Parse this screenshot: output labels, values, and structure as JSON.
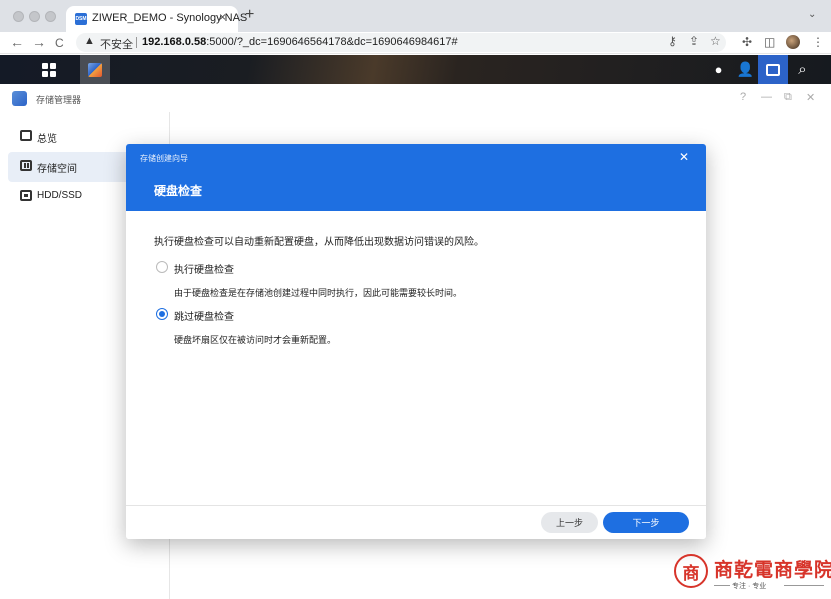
{
  "browser": {
    "tab_title": "ZIWER_DEMO - Synology NAS",
    "favicon_text": "DSM",
    "tab_close": "×",
    "new_tab": "+",
    "tab_menu": "⌄",
    "insecure_label": "不安全",
    "url_host": "192.168.0.58",
    "url_rest": ":5000/?_dc=1690646564178&dc=1690646984617#",
    "back": "←",
    "forward": "→",
    "reload": "C"
  },
  "window": {
    "title": "存储管理器",
    "help": "?",
    "minimize": "—",
    "restore": "⧉",
    "close": "✕"
  },
  "sidebar": {
    "items": [
      {
        "label": "总览",
        "active": false
      },
      {
        "label": "存储空间",
        "active": true
      },
      {
        "label": "HDD/SSD",
        "active": false
      }
    ]
  },
  "modal": {
    "wizard_title": "存储创建向导",
    "close": "✕",
    "title": "硬盘检查",
    "intro": "执行硬盘检查可以自动重新配置硬盘，从而降低出现数据访问错误的风险。",
    "options": [
      {
        "label": "执行硬盘检查",
        "desc": "由于硬盘检查是在存储池创建过程中同时执行，因此可能需要较长时间。",
        "checked": false
      },
      {
        "label": "跳过硬盘检查",
        "desc": "硬盘坏扇区仅在被访问时才会重新配置。",
        "checked": true
      }
    ],
    "prev_label": "上一步",
    "next_label": "下一步"
  },
  "watermark": {
    "logo_char": "商",
    "name": "商乾電商學院",
    "slogan": "专注 · 专业"
  },
  "colors": {
    "accent": "#1e6fe1",
    "taskbar": "#1a1d22",
    "watermark": "#d7342a"
  }
}
